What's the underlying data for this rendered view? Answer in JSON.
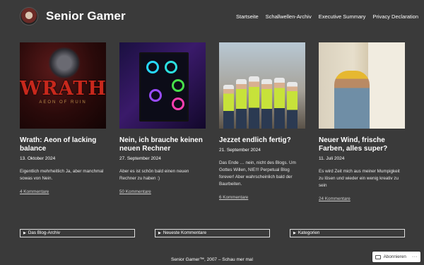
{
  "site": {
    "title": "Senior Gamer"
  },
  "nav": [
    "Startseite",
    "Schallwellen-Archiv",
    "Executive Summary",
    "Privacy Declaration"
  ],
  "posts": [
    {
      "image_brand": "WRATH",
      "image_sub": "AEON OF RUIN",
      "title": "Wrath: Aeon of lacking balance",
      "date": "13. Oktober 2024",
      "excerpt": "Eigentlich mehrheitlich Ja, aber manchmal sowas von Nein.",
      "comments": "4 Kommentare"
    },
    {
      "title": "Nein, ich brauche keinen neuen Rechner",
      "date": "27. September 2024",
      "excerpt": "Aber es ist schön bald einen neuen Rechner zu haben :)",
      "comments": "50 Kommentare"
    },
    {
      "title": "Jezzet endlich fertig?",
      "date": "21. September 2024",
      "excerpt": "Das Ende … nein, nicht des Blogs. Um Gottes Willen, NIE!!! Perpetual Blog forever! Aber wahrscheinlich bald der Baurbeiten.",
      "comments": "6 Kommentare"
    },
    {
      "title": "Neuer Wind, frische Farben, alles super?",
      "date": "11. Juli 2024",
      "excerpt": "Es wird Zeit mich aus meiner Mumpigkeit zu lösen und wieder ein wenig kreativ zu sein",
      "comments": "24 Kommentare"
    }
  ],
  "widgets": [
    "Das Blog-Archiv",
    "Neueste Kommentare",
    "Kategorien"
  ],
  "footer": "Senior Gamer™, 2007 – Schau mer mal",
  "subscribe": {
    "label": "Abonnieren",
    "more": "···"
  },
  "colors": {
    "background": "#3a3a3a",
    "text": "#ffffff"
  }
}
